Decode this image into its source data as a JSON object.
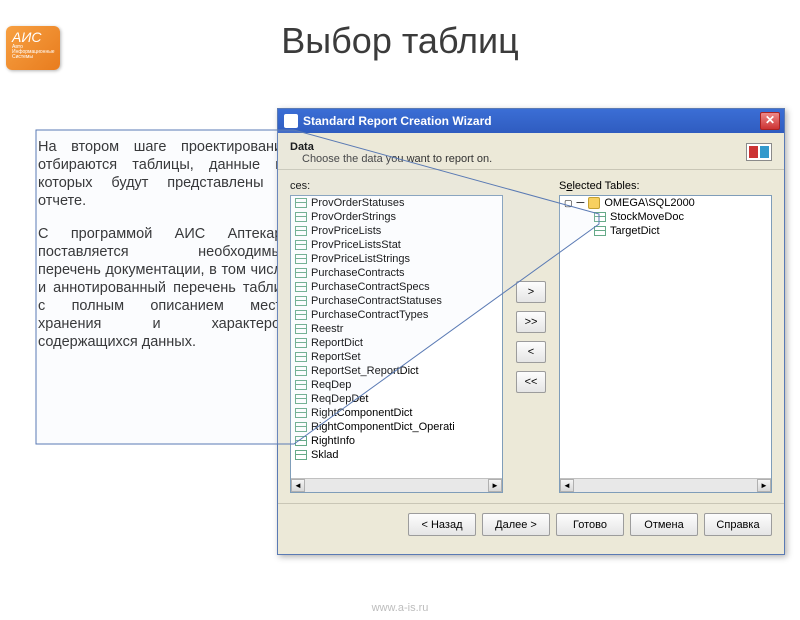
{
  "logo": {
    "main": "АИС",
    "sub1": "Авто",
    "sub2": "Информационные",
    "sub3": "Системы"
  },
  "title": "Выбор таблиц",
  "para1": "На втором шаге проектирования отбираются таблицы, данные из которых будут представлены в отчете.",
  "para2": "С программой АИС Аптекарь поставляется необходимый перечень документации, в том числе и аннотированный перечень таблиц с полным описанием места хранения и характером содержащихся данных.",
  "footer": "www.a-is.ru",
  "dialog": {
    "title": "Standard Report Creation Wizard",
    "head_title": "Data",
    "head_sub": "Choose the data you want to report on.",
    "left_label_prefix": "ces:",
    "right_label_text": "Selected Tables:",
    "right_label_u": "e",
    "left_items": [
      "ProvOrderStatuses",
      "ProvOrderStrings",
      "ProvPriceLists",
      "ProvPriceListsStat",
      "ProvPriceListStrings",
      "PurchaseContracts",
      "PurchaseContractSpecs",
      "PurchaseContractStatuses",
      "PurchaseContractTypes",
      "Reestr",
      "ReportDict",
      "ReportSet",
      "ReportSet_ReportDict",
      "ReqDep",
      "ReqDepDet",
      "RightComponentDict",
      "RightComponentDict_Operati",
      "RightInfo",
      "Sklad"
    ],
    "right_tree": {
      "root": "OMEGA\\SQL2000",
      "items": [
        "StockMoveDoc",
        "TargetDict"
      ]
    },
    "btn_add": ">",
    "btn_add_all": ">>",
    "btn_remove": "<",
    "btn_remove_all": "<<",
    "btn_back": "< Назад",
    "btn_next": "Далее >",
    "btn_finish": "Готово",
    "btn_cancel": "Отмена",
    "btn_help": "Справка"
  }
}
